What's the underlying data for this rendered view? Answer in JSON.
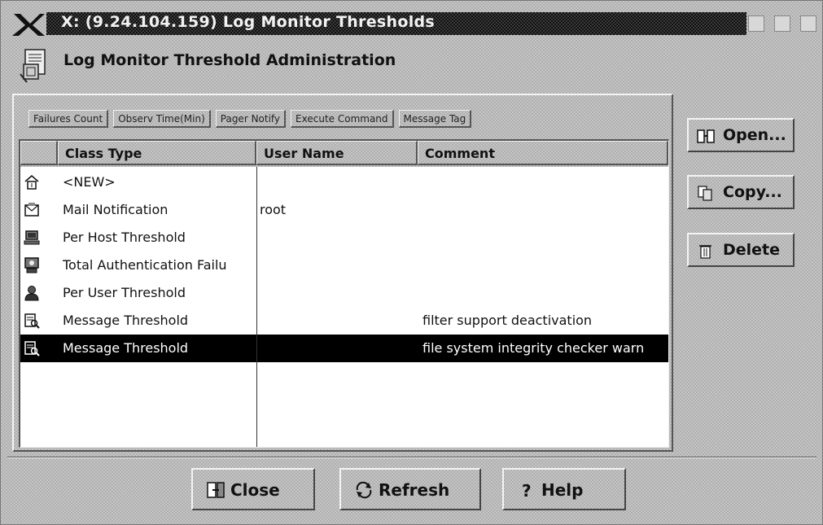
{
  "window": {
    "title": "X: (9.24.104.159) Log Monitor Thresholds",
    "logo_text": "X"
  },
  "header": {
    "title": "Log Monitor Threshold Administration",
    "icon": "document-config-icon"
  },
  "toolbar": {
    "buttons": [
      {
        "label": "Failures Count"
      },
      {
        "label": "Observ Time(Min)"
      },
      {
        "label": "Pager Notify"
      },
      {
        "label": "Execute Command"
      },
      {
        "label": "Message Tag"
      }
    ]
  },
  "table": {
    "columns": [
      "Class Type",
      "User Name",
      "Comment"
    ],
    "rows": [
      {
        "icon": "new-icon",
        "class_type": "<NEW>",
        "user_name": "",
        "comment": "",
        "selected": false
      },
      {
        "icon": "mail-notification-icon",
        "class_type": "Mail Notification",
        "user_name": "root",
        "comment": "",
        "selected": false
      },
      {
        "icon": "host-icon",
        "class_type": "Per Host Threshold",
        "user_name": "",
        "comment": "",
        "selected": false
      },
      {
        "icon": "authentication-icon",
        "class_type": "Total Authentication Failu",
        "user_name": "",
        "comment": "",
        "selected": false
      },
      {
        "icon": "user-icon",
        "class_type": "Per User Threshold",
        "user_name": "",
        "comment": "",
        "selected": false
      },
      {
        "icon": "message-icon",
        "class_type": "Message Threshold",
        "user_name": "",
        "comment": "filter support deactivation",
        "selected": false
      },
      {
        "icon": "message-icon",
        "class_type": "Message Threshold",
        "user_name": "",
        "comment": "file system integrity checker warn",
        "selected": true
      }
    ]
  },
  "side_buttons": {
    "open": {
      "label": "Open...",
      "icon": "open-icon"
    },
    "copy": {
      "label": "Copy...",
      "icon": "copy-icon"
    },
    "delete": {
      "label": "Delete",
      "icon": "trash-icon"
    }
  },
  "bottom_buttons": {
    "close": {
      "label": "Close",
      "icon": "close-door-icon"
    },
    "refresh": {
      "label": "Refresh",
      "icon": "refresh-icon"
    },
    "help": {
      "label": "Help",
      "icon": "help-icon"
    }
  },
  "colors": {
    "background": "#c4c4c4",
    "title_bar": "#1a1a1a",
    "selection": "#000000",
    "table_bg": "#ffffff"
  }
}
